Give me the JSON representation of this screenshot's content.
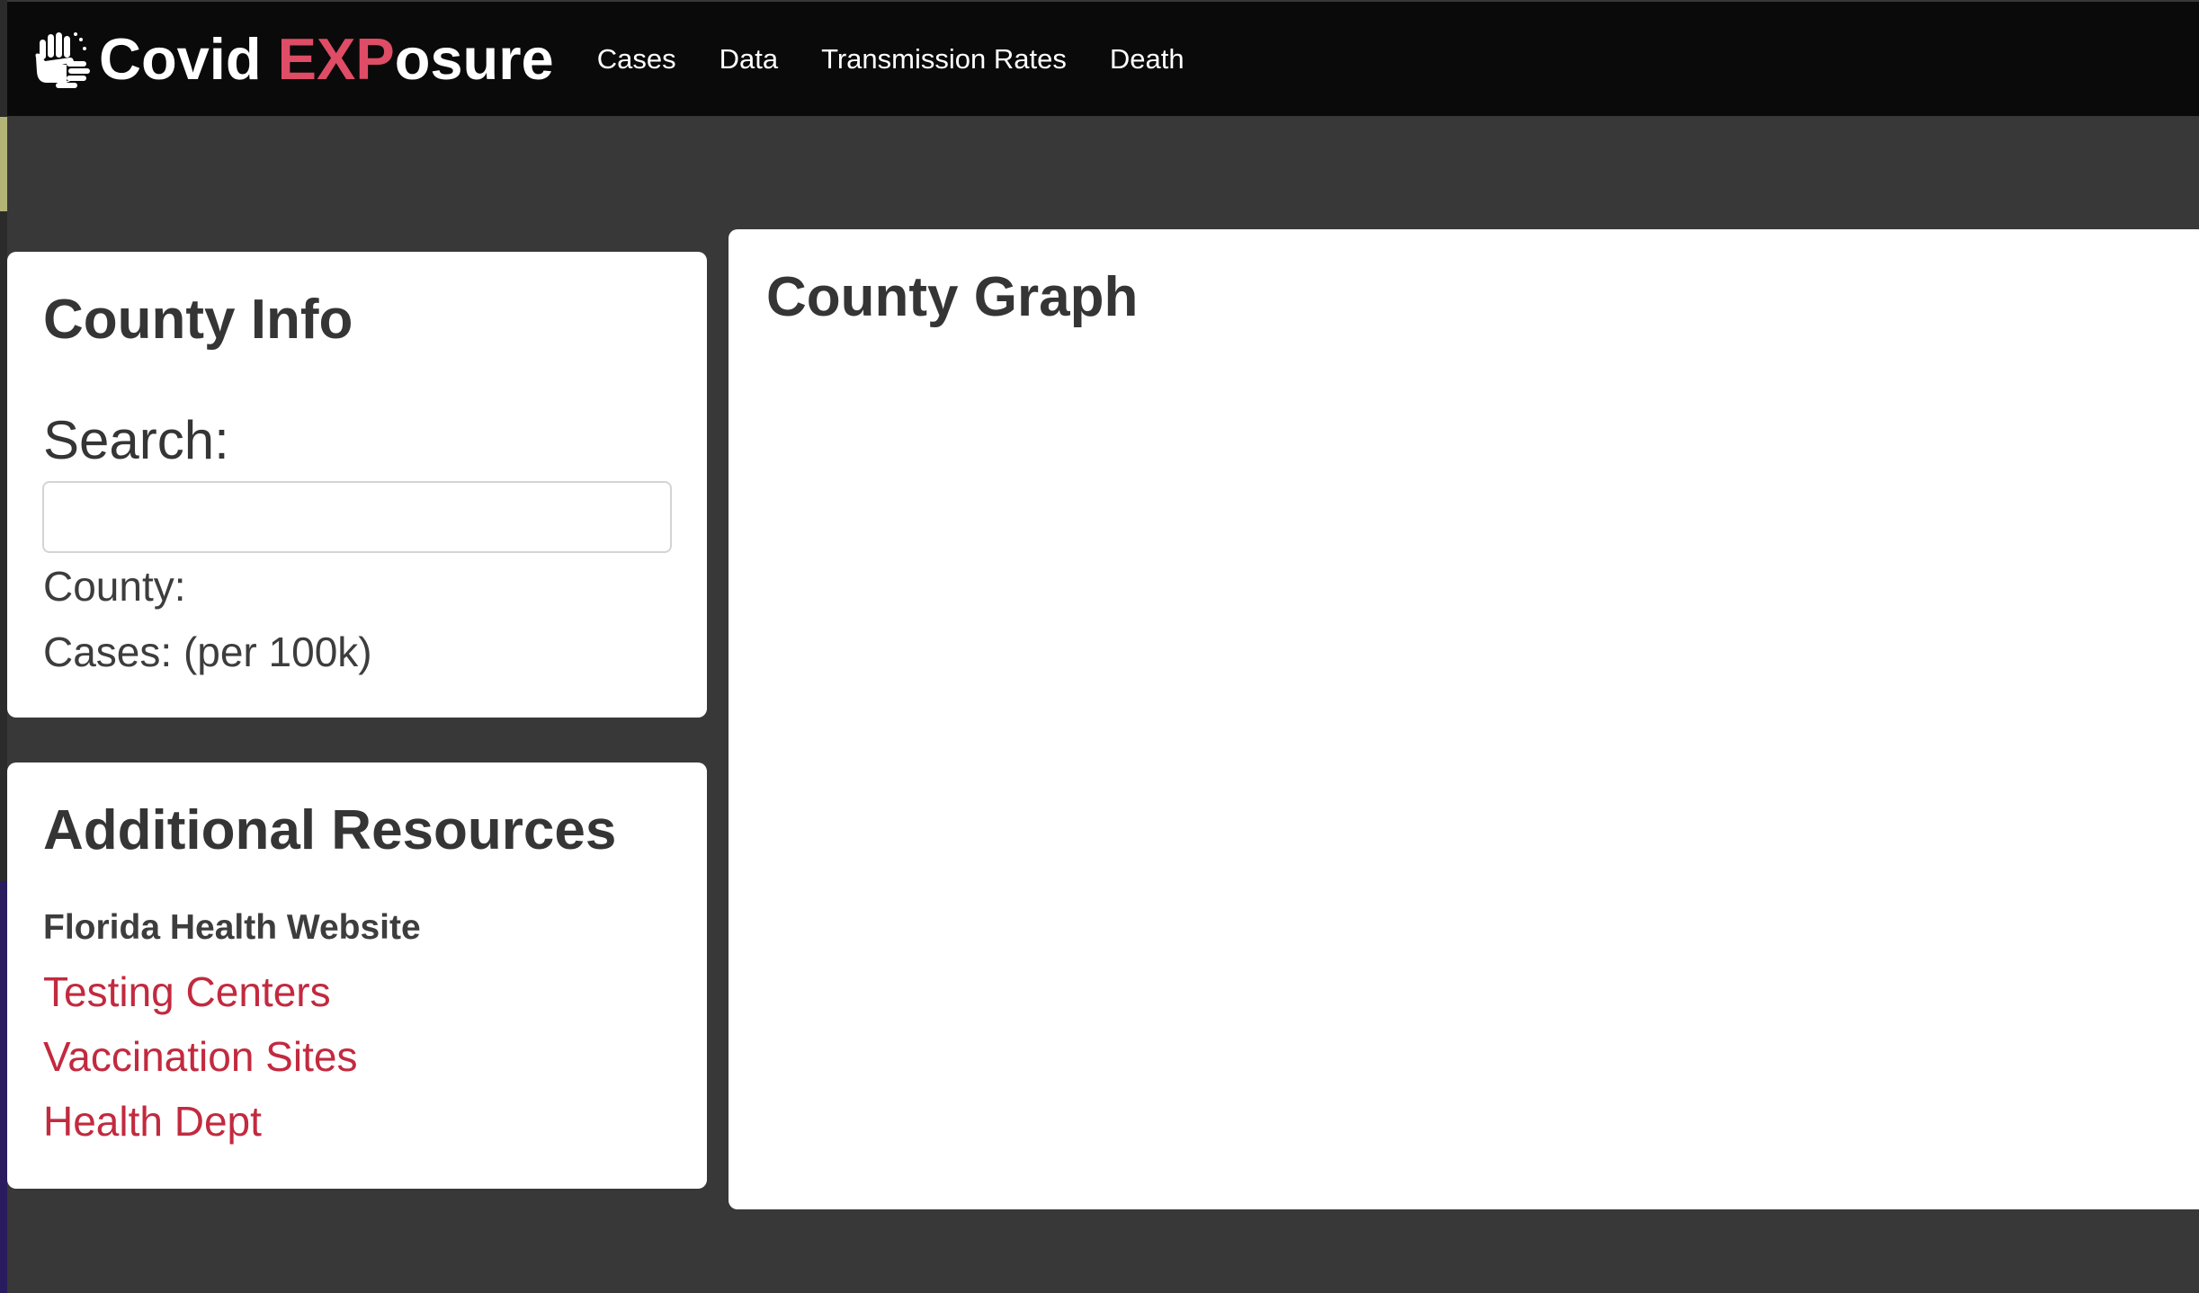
{
  "brand": {
    "name_prefix": "Covid ",
    "name_accent": "EXP",
    "name_suffix": "osure",
    "icon": "hands-icon",
    "accent_color": "#df4c66"
  },
  "nav": {
    "items": [
      {
        "label": "Cases"
      },
      {
        "label": "Data"
      },
      {
        "label": "Transmission Rates"
      },
      {
        "label": "Death"
      }
    ]
  },
  "county_info": {
    "title": "County Info",
    "search_label": "Search:",
    "search_value": "",
    "search_placeholder": "",
    "county_label": "County:",
    "cases_label": "Cases: (per 100k)"
  },
  "resources": {
    "title": "Additional Resources",
    "heading": "Florida Health Website",
    "links": [
      {
        "label": "Testing Centers"
      },
      {
        "label": "Vaccination Sites"
      },
      {
        "label": "Health Dept"
      }
    ],
    "link_color": "#c22a3f"
  },
  "graph": {
    "title": "County Graph"
  }
}
